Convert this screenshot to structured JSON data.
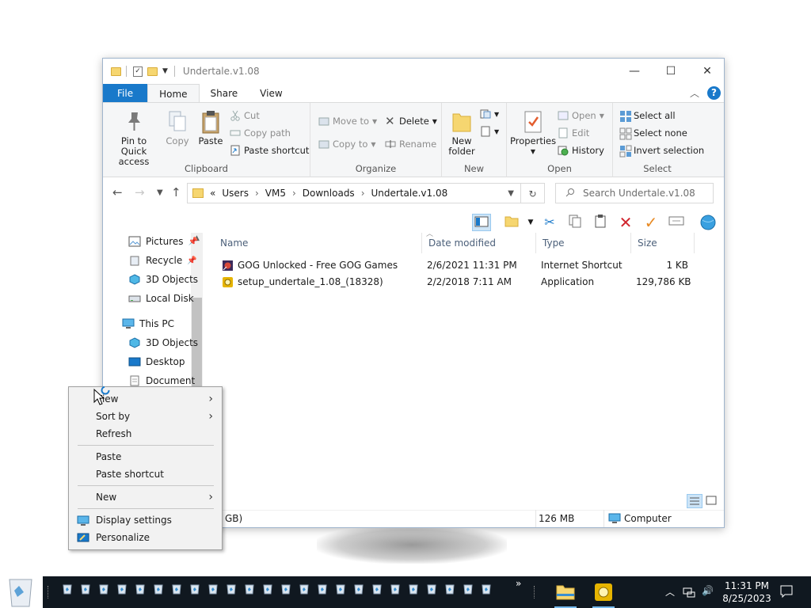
{
  "window": {
    "title": "Undertale.v1.08",
    "controls": {
      "minimize": "—",
      "maximize": "☐",
      "close": "✕"
    }
  },
  "ribbon_tabs": [
    "File",
    "Home",
    "Share",
    "View"
  ],
  "ribbon": {
    "clipboard": {
      "label": "Clipboard",
      "pin": "Pin to Quick access",
      "copy": "Copy",
      "paste": "Paste",
      "cut": "Cut",
      "copy_path": "Copy path",
      "paste_shortcut": "Paste shortcut"
    },
    "organize": {
      "label": "Organize",
      "move_to": "Move to",
      "copy_to": "Copy to",
      "delete": "Delete",
      "rename": "Rename"
    },
    "new": {
      "label": "New",
      "new_folder": "New folder"
    },
    "open": {
      "label": "Open",
      "properties": "Properties",
      "open": "Open",
      "edit": "Edit",
      "history": "History"
    },
    "select": {
      "label": "Select",
      "select_all": "Select all",
      "select_none": "Select none",
      "invert": "Invert selection"
    }
  },
  "address": {
    "overflow": "«",
    "crumbs": [
      "Users",
      "VM5",
      "Downloads",
      "Undertale.v1.08"
    ],
    "search_placeholder": "Search Undertale.v1.08"
  },
  "nav": {
    "quick": [
      "Pictures",
      "Recycle",
      "3D Objects",
      "Local Disk"
    ],
    "this_pc": "This PC",
    "pc_items": [
      "3D Objects",
      "Desktop",
      "Document"
    ]
  },
  "columns": [
    "Name",
    "Date modified",
    "Type",
    "Size"
  ],
  "files": [
    {
      "name": "GOG Unlocked - Free GOG Games",
      "date": "2/6/2021 11:31 PM",
      "type": "Internet Shortcut",
      "size": "1 KB"
    },
    {
      "name": "setup_undertale_1.08_(18328)",
      "date": "2/2/2018 7:11 AM",
      "type": "Application",
      "size": "129,786 KB"
    }
  ],
  "status": {
    "left": "GB)",
    "size": "126 MB",
    "location": "Computer"
  },
  "context_menu": {
    "view": "View",
    "sort_by": "Sort by",
    "refresh": "Refresh",
    "paste": "Paste",
    "paste_shortcut": "Paste shortcut",
    "new": "New",
    "display_settings": "Display settings",
    "personalize": "Personalize"
  },
  "taskbar": {
    "overflow": "»",
    "time": "11:31 PM",
    "date": "8/25/2023"
  },
  "colors": {
    "accent": "#1979ca",
    "taskbar": "#101820",
    "folder": "#f6d670"
  }
}
